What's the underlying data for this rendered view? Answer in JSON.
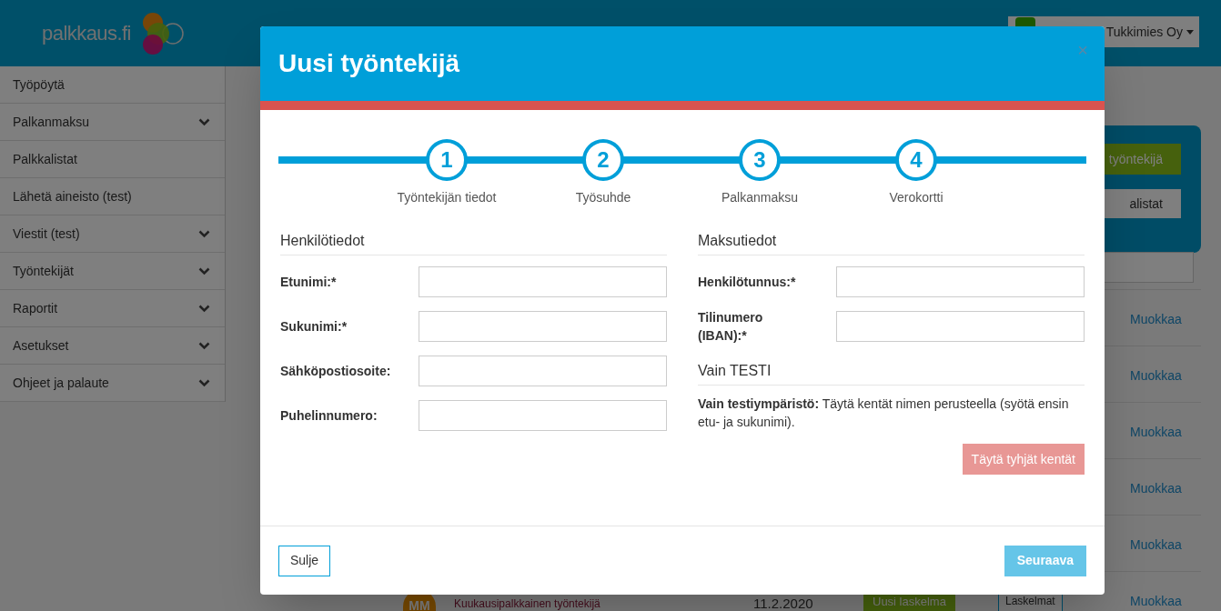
{
  "background": {
    "logo": "palkkaus.fi",
    "company": "Tukkimies Oy",
    "sidebar": [
      {
        "label": "Työpöytä",
        "expandable": false
      },
      {
        "label": "Palkanmaksu",
        "expandable": true
      },
      {
        "label": "Palkkalistat",
        "expandable": false
      },
      {
        "label": "Lähetä aineisto (test)",
        "expandable": false
      },
      {
        "label": "Viestit (test)",
        "expandable": true
      },
      {
        "label": "Työntekijät",
        "expandable": true
      },
      {
        "label": "Raportit",
        "expandable": true
      },
      {
        "label": "Asetukset",
        "expandable": true
      },
      {
        "label": "Ohjeet ja palaute",
        "expandable": true
      }
    ],
    "actions": [
      {
        "label": "työntekijä",
        "kind": "primary"
      },
      {
        "label": "alistat",
        "kind": "secondary"
      }
    ],
    "rows": [
      {
        "action": "Muokkaa"
      },
      {
        "action": "Muokkaa"
      },
      {
        "action": "Muokkaa"
      },
      {
        "action": "Muokkaa"
      },
      {
        "action": "Muokkaa"
      },
      {
        "action": "Muokkaa",
        "initials": "MM",
        "description": "Kuukausipalkkainen työntekijä",
        "date": "11.2.2020",
        "button": "Uusi laskelma",
        "secondary": "Laskelmat"
      }
    ]
  },
  "dialog": {
    "title": "Uusi työntekijä",
    "close": "×",
    "steps": [
      {
        "number": "1",
        "label": "Työntekijän tiedot"
      },
      {
        "number": "2",
        "label": "Työsuhde"
      },
      {
        "number": "3",
        "label": "Palkanmaksu"
      },
      {
        "number": "4",
        "label": "Verokortti"
      }
    ],
    "left": {
      "heading": "Henkilötiedot",
      "fields": [
        {
          "label": "Etunimi:*"
        },
        {
          "label": "Sukunimi:*"
        },
        {
          "label": "Sähköpostiosoite:"
        },
        {
          "label": "Puhelinnumero:"
        }
      ]
    },
    "right": {
      "heading": "Maksutiedot",
      "fields": [
        {
          "label": "Henkilötunnus:*"
        },
        {
          "label": "Tilinumero (IBAN):*"
        }
      ]
    },
    "test": {
      "heading": "Vain TESTI",
      "note": "**Vain testiympäristö:** Täytä kentät nimen perusteella (syötä ensin etu- ja sukunimi).",
      "button": {
        "label": "Täytä tyhjät kentät",
        "disabled": true
      }
    },
    "footer": {
      "close": {
        "label": "Sulje",
        "disabled": false
      },
      "next": {
        "label": "Seuraava",
        "disabled": true
      }
    }
  }
}
